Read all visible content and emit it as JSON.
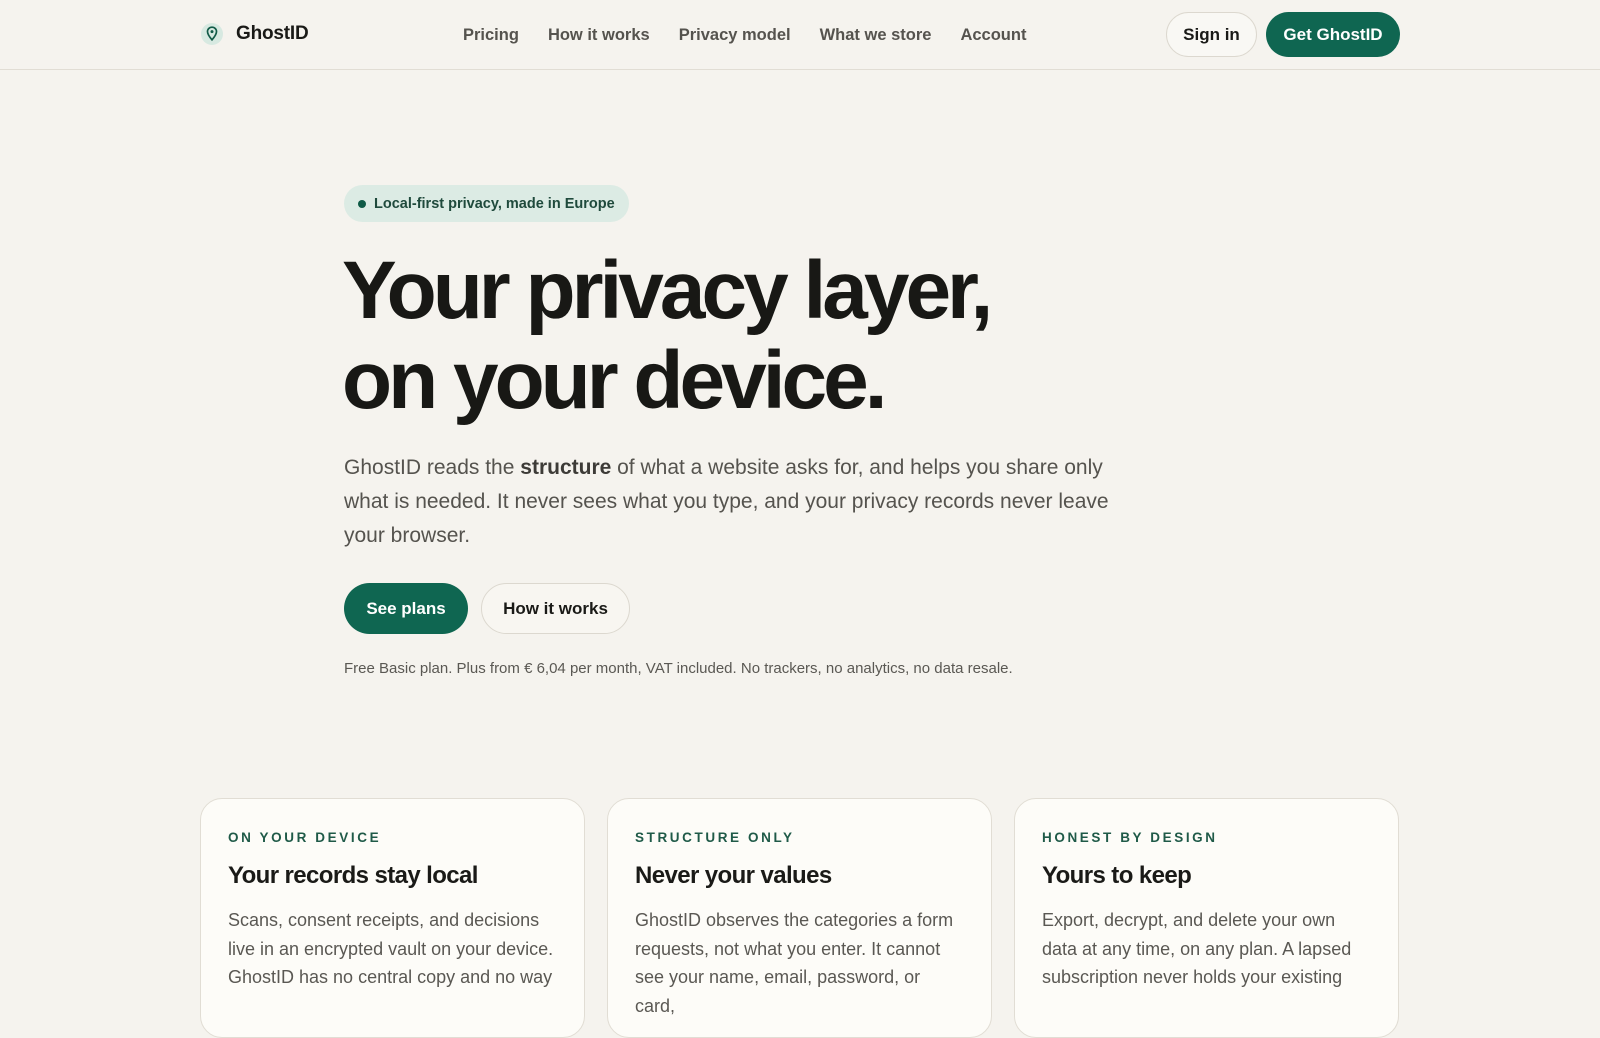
{
  "header": {
    "brand": "GhostID",
    "nav": [
      "Pricing",
      "How it works",
      "Privacy model",
      "What we store",
      "Account"
    ],
    "sign_in": "Sign in",
    "cta": "Get GhostID"
  },
  "hero": {
    "badge": "Local-first privacy, made in Europe",
    "headline_line1": "Your privacy layer,",
    "headline_line2": "on your device.",
    "lede_before": "GhostID reads the ",
    "lede_bold": "structure",
    "lede_after": " of what a website asks for, and helps you share only what is needed. It never sees what you type, and your privacy records never leave your browser.",
    "primary_button": "See plans",
    "secondary_button": "How it works",
    "fineprint": "Free Basic plan. Plus from € 6,04 per month, VAT included. No trackers, no analytics, no data resale."
  },
  "cards": [
    {
      "eyebrow": "ON YOUR DEVICE",
      "title": "Your records stay local",
      "body": "Scans, consent receipts, and decisions live in an encrypted vault on your device. GhostID has no central copy and no way"
    },
    {
      "eyebrow": "STRUCTURE ONLY",
      "title": "Never your values",
      "body": "GhostID observes the categories a form requests, not what you enter. It cannot see your name, email, password, or card,"
    },
    {
      "eyebrow": "HONEST BY DESIGN",
      "title": "Yours to keep",
      "body": "Export, decrypt, and delete your own data at any time, on any plan. A lapsed subscription never holds your existing"
    }
  ],
  "colors": {
    "accent": "#0f6651",
    "background": "#f5f3ee",
    "badge_bg": "#dcebe4"
  }
}
